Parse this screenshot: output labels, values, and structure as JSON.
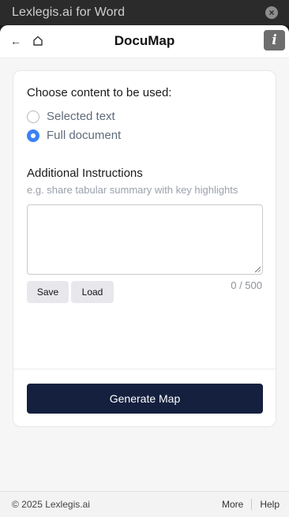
{
  "titlebar": {
    "title": "Lexlegis.ai for Word",
    "close_icon": "close-circle-icon"
  },
  "header": {
    "back_icon": "arrow-left-icon",
    "home_icon": "home-icon",
    "title": "DocuMap",
    "info_glyph": "i"
  },
  "content_choice": {
    "label": "Choose content to be used:",
    "options": [
      {
        "label": "Selected text",
        "checked": false
      },
      {
        "label": "Full document",
        "checked": true
      }
    ]
  },
  "instructions": {
    "label": "Additional Instructions",
    "hint": "e.g. share tabular summary with key highlights",
    "value": "",
    "counter": "0 / 500",
    "save_label": "Save",
    "load_label": "Load"
  },
  "generate_label": "Generate Map",
  "footer": {
    "copyright": "© 2025 Lexlegis.ai",
    "more": "More",
    "help": "Help"
  },
  "colors": {
    "accent": "#3b82f6",
    "primary_button": "#15203f"
  }
}
